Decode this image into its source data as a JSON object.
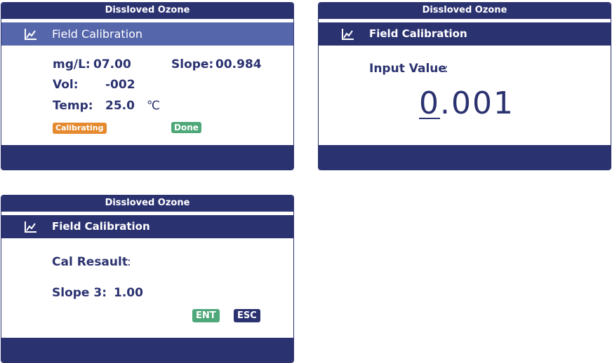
{
  "colors": {
    "navy": "#2b3270",
    "header_active": "#5666ab",
    "orange": "#e58a2f",
    "green": "#4fa879"
  },
  "screen1": {
    "top_title": "Dissloved Ozone",
    "icon": "chart-line-icon",
    "title": "Field Calibration",
    "mg_label": "mg/L:",
    "mg_value": "07.00",
    "slope_label": "Slope:",
    "slope_value": "00.984",
    "vol_label": "Vol:",
    "vol_value": "-002",
    "temp_label": "Temp:",
    "temp_value": "25.0",
    "temp_unit": "℃",
    "status_calibrating": "Calibrating",
    "status_done": "Done"
  },
  "screen2": {
    "top_title": "Dissloved Ozone",
    "icon": "chart-line-icon",
    "title": "Field Calibration",
    "input_label": "Input Value",
    "input_colon": ":",
    "value_cursor_digit": "0",
    "value_rest": ".001"
  },
  "screen3": {
    "top_title": "Dissloved Ozone",
    "icon": "chart-line-icon",
    "title": "Field Calibration",
    "result_label": "Cal Resault",
    "result_colon": ":",
    "slope_label": "Slope 3:",
    "slope_value": "1.00",
    "ent_label": "ENT",
    "esc_label": "ESC"
  }
}
